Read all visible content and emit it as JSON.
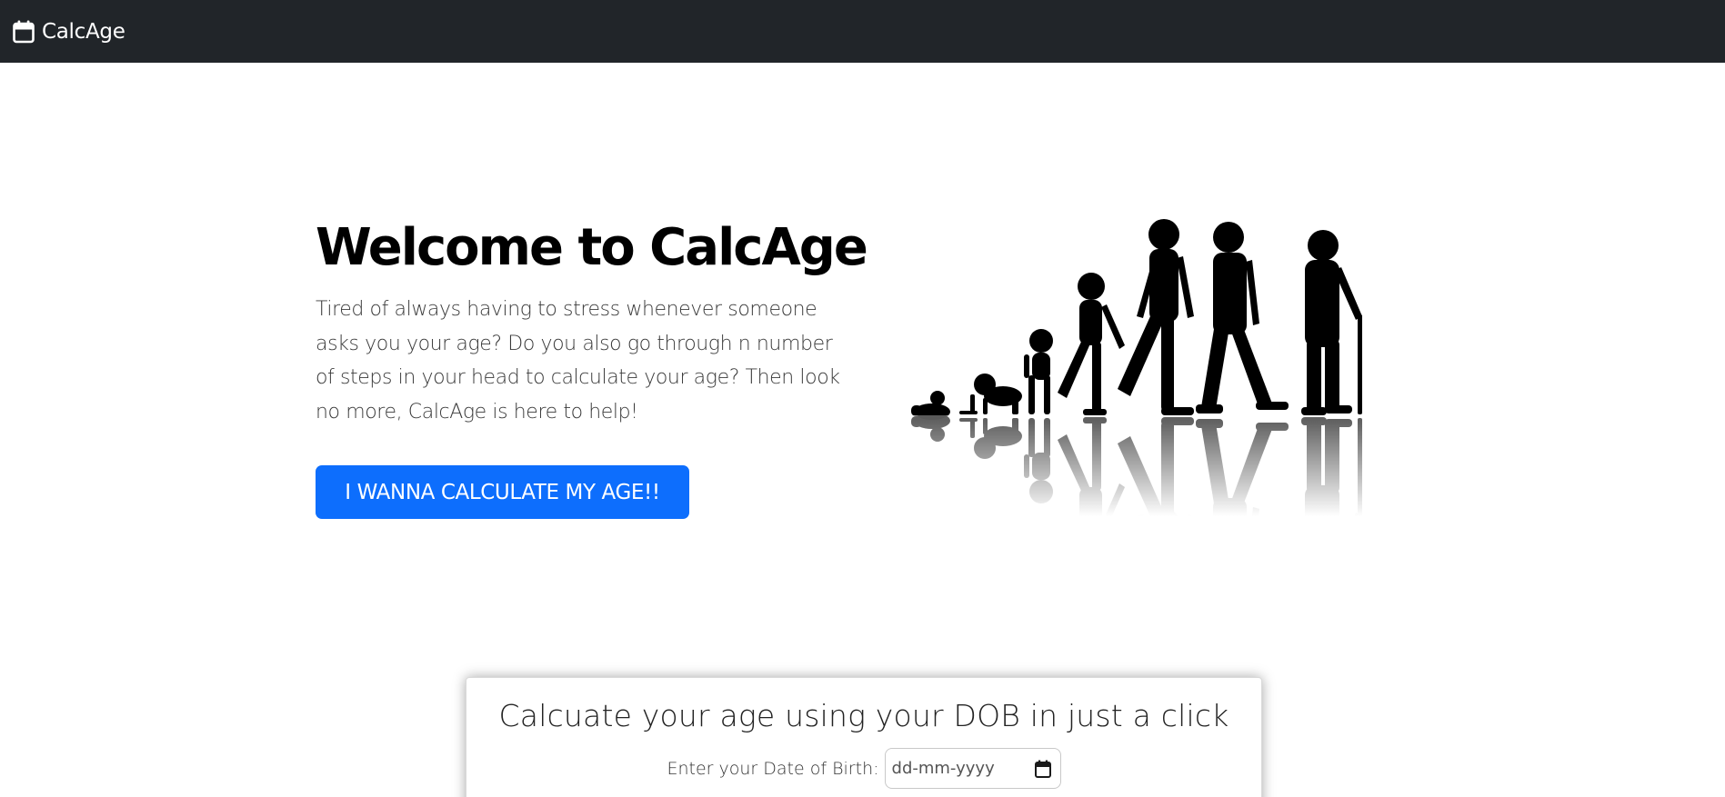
{
  "navbar": {
    "brand_icon": "calendar-icon",
    "brand_name": "CalcAge",
    "background": "#212529"
  },
  "hero": {
    "title": "Welcome to CalcAge",
    "description": "Tired of always having to stress whenever someone asks you your age? Do you also go through n number of steps in your head to calculate your age? Then look no more, CalcAge is here to help!",
    "cta_label": "I WANNA CALCULATE MY AGE!!",
    "cta_color": "#0d6efd",
    "image": "human-life-stages-silhouette-image"
  },
  "calculator": {
    "title": "Calcuate your age using your DOB in just a click",
    "dob_label": "Enter your Date of Birth:",
    "dob_placeholder": "dd-mm-yyyy",
    "dob_icon": "calendar-icon"
  }
}
